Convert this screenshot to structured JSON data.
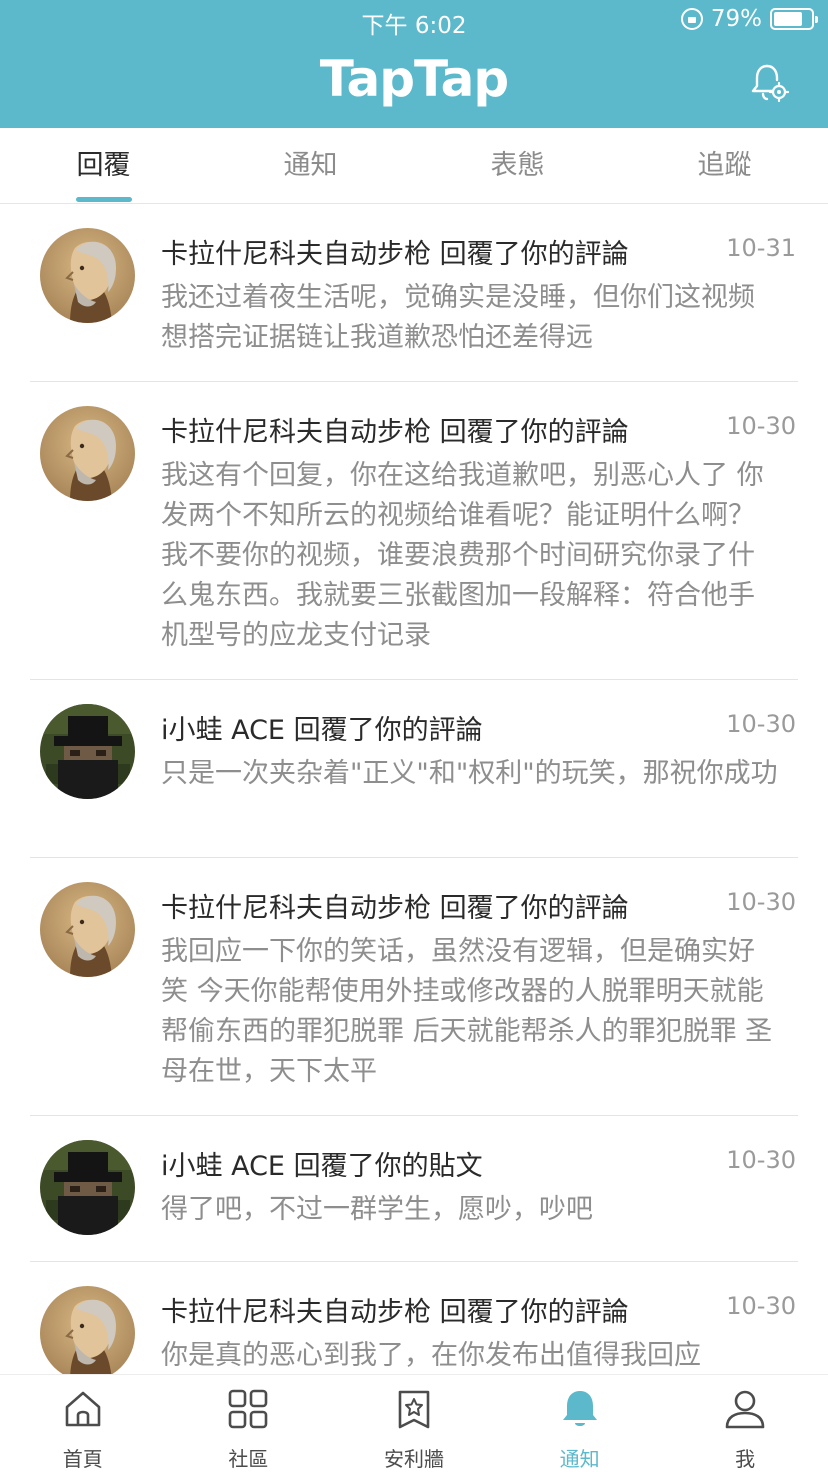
{
  "status_bar": {
    "time": "下午 6:02",
    "battery": "79%",
    "battery_level": 0.79
  },
  "header": {
    "title": "TapTap",
    "settings_icon": "bell-settings-icon"
  },
  "tabs": [
    {
      "label": "回覆",
      "active": true
    },
    {
      "label": "通知",
      "active": false
    },
    {
      "label": "表態",
      "active": false
    },
    {
      "label": "追蹤",
      "active": false
    }
  ],
  "notifications": [
    {
      "avatar": "elder-portrait-avatar",
      "title": "卡拉什尼科夫自动步枪 回覆了你的評論",
      "date": "10-31",
      "body": "我还过着夜生活呢，觉确实是没睡，但你们这视频想搭完证据链让我道歉恐怕还差得远"
    },
    {
      "avatar": "elder-portrait-avatar",
      "title": "卡拉什尼科夫自动步枪 回覆了你的評論",
      "date": "10-30",
      "body": "我这有个回复，你在这给我道歉吧，别恶心人了 你发两个不知所云的视频给谁看呢？能证明什么啊？ 我不要你的视频，谁要浪费那个时间研究你录了什么鬼东西。我就要三张截图加一段解释：符合他手机型号的应龙支付记录"
    },
    {
      "avatar": "pixel-hat-avatar",
      "title": "i小蛙 ACE 回覆了你的評論",
      "date": "10-30",
      "body": "只是一次夹杂着\"正义\"和\"权利\"的玩笑，那祝你成功"
    },
    {
      "avatar": "elder-portrait-avatar",
      "title": "卡拉什尼科夫自动步枪 回覆了你的評論",
      "date": "10-30",
      "body": "我回应一下你的笑话，虽然没有逻辑，但是确实好笑 今天你能帮使用外挂或修改器的人脱罪明天就能帮偷东西的罪犯脱罪 后天就能帮杀人的罪犯脱罪 圣母在世，天下太平"
    },
    {
      "avatar": "pixel-hat-avatar",
      "title": "i小蛙 ACE 回覆了你的貼文",
      "date": "10-30",
      "body": "得了吧，不过一群学生，愿吵，吵吧"
    },
    {
      "avatar": "elder-portrait-avatar",
      "title": "卡拉什尼科夫自动步枪 回覆了你的評論",
      "date": "10-30",
      "body": "你是真的恶心到我了，在你发布出值得我回应"
    }
  ],
  "bottom_nav": [
    {
      "label": "首頁",
      "icon": "home-icon",
      "active": false
    },
    {
      "label": "社區",
      "icon": "grid-icon",
      "active": false
    },
    {
      "label": "安利牆",
      "icon": "star-badge-icon",
      "active": false
    },
    {
      "label": "通知",
      "icon": "bell-icon",
      "active": true
    },
    {
      "label": "我",
      "icon": "user-icon",
      "active": false
    }
  ],
  "colors": {
    "brand": "#5bb9cb",
    "text": "#2a2a2a",
    "muted": "#8e8e8e"
  }
}
